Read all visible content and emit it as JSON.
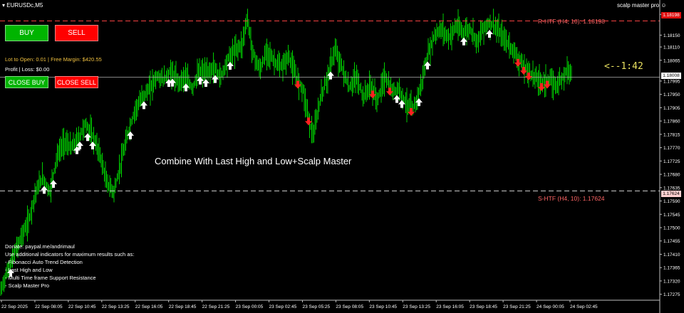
{
  "window": {
    "symbol": "EURUSDc,M5",
    "indicator": "scalp master pro"
  },
  "buttons": {
    "buy": "BUY",
    "sell": "SELL",
    "close_buy": "CLOSE BUY",
    "close_sell": "CLOSE SELL"
  },
  "info": {
    "lot_line": "Lot to Open: 0.01 | Free Margin: $420.55",
    "profit_line": "Profit | Loss: $0.00"
  },
  "overlay_text": "Combine With Last High and Low+Scalp Master",
  "timer": "<--1:42",
  "levels": {
    "resistance": "R-HTF (H4, 10): 1.18198",
    "support": "S-HTF (H4, 10): 1.17624"
  },
  "ad_lines": [
    "Donate: paypal.me/andrimaul",
    "Use additional indicators for maximum results such as:",
    "- Fibonacci Auto Trend Detection",
    "- Last High and Low",
    "- Multi Time frame Support Resistance",
    "- Scalp Master Pro"
  ],
  "colors": {
    "candle": "#00cc00",
    "buy_arrow": "#ffffff",
    "sell_arrow": "#ff2020",
    "level": "#ff4444",
    "bid_line": "#b0b0b0"
  },
  "chart_data": {
    "type": "line",
    "title": "",
    "price_axis_labels": [
      "1.18220",
      "1.18150",
      "1.18110",
      "1.18065",
      "1.17995",
      "1.17950",
      "1.17905",
      "1.17860",
      "1.17815",
      "1.17770",
      "1.17725",
      "1.17680",
      "1.17635",
      "1.17590",
      "1.17545",
      "1.17500",
      "1.17455",
      "1.17410",
      "1.17365",
      "1.17320",
      "1.17275"
    ],
    "time_axis_labels": [
      "22 Sep 2025",
      "22 Sep 08:05",
      "22 Sep 10:45",
      "22 Sep 13:25",
      "22 Sep 16:05",
      "22 Sep 18:45",
      "22 Sep 21:25",
      "23 Sep 00:05",
      "23 Sep 02:45",
      "23 Sep 05:25",
      "23 Sep 08:05",
      "23 Sep 10:45",
      "23 Sep 13:25",
      "23 Sep 16:05",
      "23 Sep 18:45",
      "23 Sep 21:25",
      "24 Sep 00:05",
      "24 Sep 02:45"
    ],
    "current_price": "1.18008",
    "resistance_price": "1.18198",
    "support_price": "1.17624",
    "price_series": [
      [
        0,
        1.1728
      ],
      [
        10,
        1.1735
      ],
      [
        20,
        1.1741
      ],
      [
        30,
        1.1747
      ],
      [
        40,
        1.1752
      ],
      [
        50,
        1.1762
      ],
      [
        60,
        1.1767
      ],
      [
        70,
        1.1762
      ],
      [
        80,
        1.1774
      ],
      [
        90,
        1.1779
      ],
      [
        100,
        1.1777
      ],
      [
        110,
        1.178
      ],
      [
        120,
        1.1785
      ],
      [
        130,
        1.1781
      ],
      [
        140,
        1.1775
      ],
      [
        150,
        1.1765
      ],
      [
        160,
        1.1762
      ],
      [
        170,
        1.1772
      ],
      [
        180,
        1.1782
      ],
      [
        190,
        1.179
      ],
      [
        200,
        1.1794
      ],
      [
        210,
        1.1797
      ],
      [
        220,
        1.1801
      ],
      [
        230,
        1.18
      ],
      [
        240,
        1.1803
      ],
      [
        250,
        1.1799
      ],
      [
        260,
        1.1801
      ],
      [
        270,
        1.1797
      ],
      [
        280,
        1.1803
      ],
      [
        290,
        1.1802
      ],
      [
        300,
        1.1804
      ],
      [
        310,
        1.1801
      ],
      [
        320,
        1.1807
      ],
      [
        330,
        1.181
      ],
      [
        340,
        1.1812
      ],
      [
        347,
        1.1821
      ],
      [
        355,
        1.1809
      ],
      [
        365,
        1.1803
      ],
      [
        375,
        1.181
      ],
      [
        385,
        1.1806
      ],
      [
        395,
        1.1804
      ],
      [
        405,
        1.1808
      ],
      [
        415,
        1.1801
      ],
      [
        425,
        1.1797
      ],
      [
        435,
        1.1785
      ],
      [
        440,
        1.1781
      ],
      [
        450,
        1.1794
      ],
      [
        460,
        1.1801
      ],
      [
        470,
        1.181
      ],
      [
        480,
        1.1804
      ],
      [
        490,
        1.1797
      ],
      [
        500,
        1.1801
      ],
      [
        510,
        1.1794
      ],
      [
        520,
        1.1798
      ],
      [
        530,
        1.1793
      ],
      [
        540,
        1.1801
      ],
      [
        550,
        1.1796
      ],
      [
        560,
        1.1797
      ],
      [
        570,
        1.1792
      ],
      [
        580,
        1.179
      ],
      [
        590,
        1.1797
      ],
      [
        600,
        1.1808
      ],
      [
        610,
        1.1815
      ],
      [
        620,
        1.1817
      ],
      [
        630,
        1.1814
      ],
      [
        640,
        1.1818
      ],
      [
        650,
        1.1816
      ],
      [
        660,
        1.1817
      ],
      [
        670,
        1.1813
      ],
      [
        680,
        1.1818
      ],
      [
        690,
        1.1819
      ],
      [
        700,
        1.1816
      ],
      [
        710,
        1.1813
      ],
      [
        720,
        1.181
      ],
      [
        730,
        1.1806
      ],
      [
        740,
        1.1803
      ],
      [
        750,
        1.1801
      ],
      [
        760,
        1.1799
      ],
      [
        770,
        1.18
      ],
      [
        780,
        1.1798
      ],
      [
        790,
        1.1801
      ],
      [
        797,
        1.1804
      ],
      [
        803,
        1.1801
      ]
    ],
    "buy_signal_x": [
      15,
      62,
      75,
      108,
      112,
      123,
      130,
      183,
      202,
      237,
      242,
      261,
      281,
      289,
      302,
      323,
      464,
      557,
      564,
      588,
      600,
      651,
      687
    ],
    "sell_signal_x": [
      418,
      433,
      523,
      547,
      577,
      727,
      735,
      742,
      760,
      768
    ]
  }
}
